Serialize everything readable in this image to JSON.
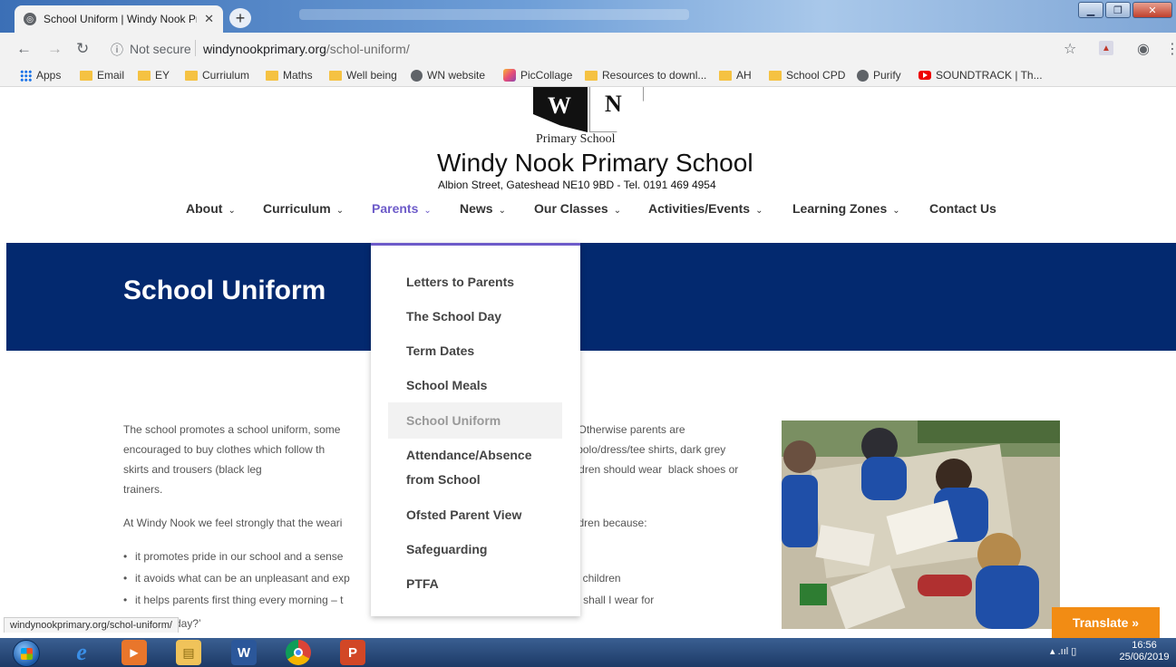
{
  "browser": {
    "tab_title": "School Uniform | Windy Nook Pr",
    "security_label": "Not secure",
    "url_domain": "windynookprimary.org",
    "url_path": "/schol-uniform/",
    "bookmarks": [
      "Apps",
      "Email",
      "EY",
      "Curriulum",
      "Maths",
      "Well being",
      "WN website",
      "PicCollage",
      "Resources to downl...",
      "AH",
      "School CPD",
      "Purify",
      "SOUNDTRACK | Th..."
    ],
    "status_url": "windynookprimary.org/schol-uniform/"
  },
  "site": {
    "logo_letter_left": "W",
    "logo_letter_right": "N",
    "logo_subtitle": "Primary  School",
    "title": "Windy Nook Primary School",
    "address": "Albion Street, Gateshead NE10 9BD - Tel. 0191 469 4954",
    "accent_color": "#6d5bc9",
    "hero_color": "#03296f"
  },
  "nav": {
    "items": [
      "About",
      "Curriculum",
      "Parents",
      "News",
      "Our Classes",
      "Activities/Events",
      "Learning Zones",
      "Contact Us"
    ],
    "active": "Parents"
  },
  "page": {
    "title": "School Uniform",
    "para1": "The school promotes a school uniform, some                                                                    chool. Otherwise parents are encouraged to buy clothes which follow th                                                                    rts, white polo/dress/tee shirts, dark grey skirts and trousers (black leg                                                                    school uniform). All children should wear  black shoes or trainers.",
    "para2": "At Windy Nook we feel strongly that the weari                                                                    all children because:",
    "bullets": [
      "it promotes pride in our school and a sense",
      "it avoids what can be an unpleasant and exp                                                                    nong children",
      "it helps parents first thing every morning – t                                                                    t ‘what shall I wear for"
    ],
    "cut_line": "day?’"
  },
  "dropdown": {
    "items": [
      "Letters to Parents",
      "The School Day",
      "Term Dates",
      "School Meals",
      "School Uniform",
      "Attendance/Absence from School",
      "Ofsted Parent View",
      "Safeguarding",
      "PTFA"
    ],
    "current": "School Uniform"
  },
  "widgets": {
    "translate_label": "Translate »"
  },
  "taskbar": {
    "time": "16:56",
    "date": "25/06/2019"
  }
}
